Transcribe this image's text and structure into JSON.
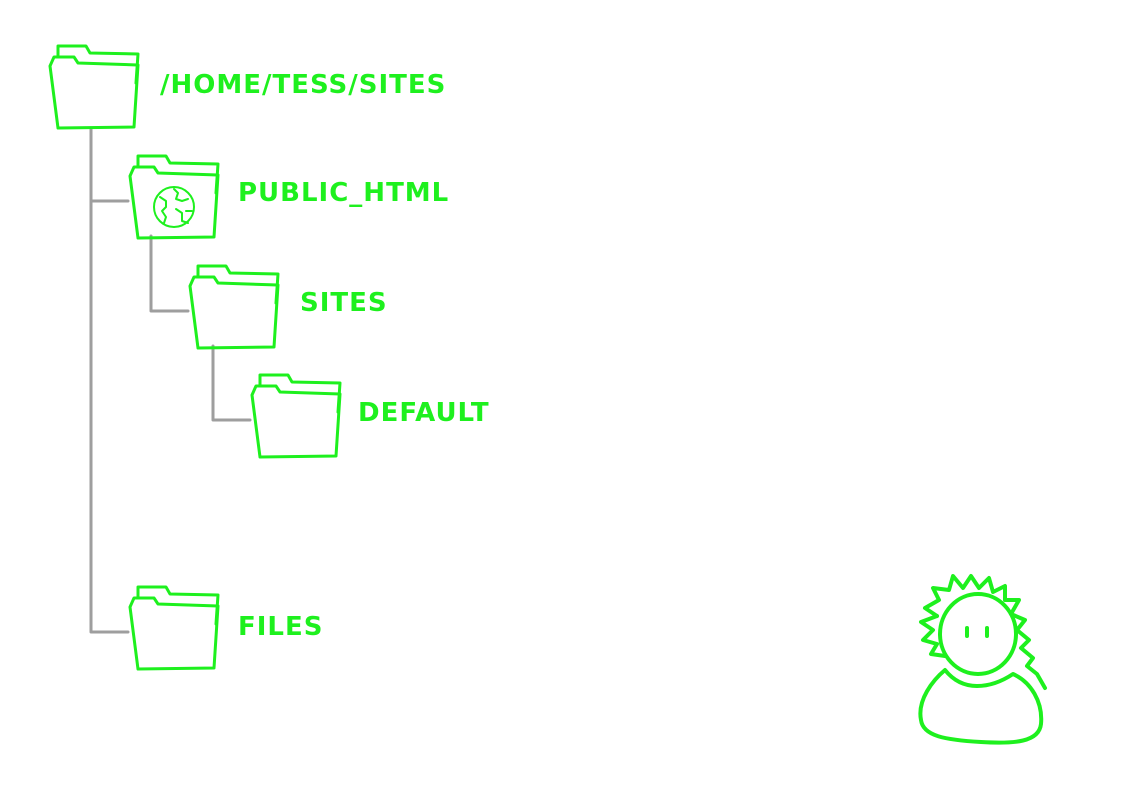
{
  "colors": {
    "accent": "#1ef01e",
    "line": "#9e9e9e",
    "background": "#ffffff"
  },
  "tree": {
    "root": {
      "label": "/HOME/TESS/SITES",
      "icon": "folder-icon"
    },
    "public_html": {
      "label": "PUBLIC_HTML",
      "icon": "web-folder-icon"
    },
    "sites": {
      "label": "SITES",
      "icon": "folder-icon"
    },
    "default": {
      "label": "DEFAULT",
      "icon": "folder-icon"
    },
    "files": {
      "label": "FILES",
      "icon": "folder-icon"
    }
  },
  "figure": {
    "icon": "person-icon"
  }
}
